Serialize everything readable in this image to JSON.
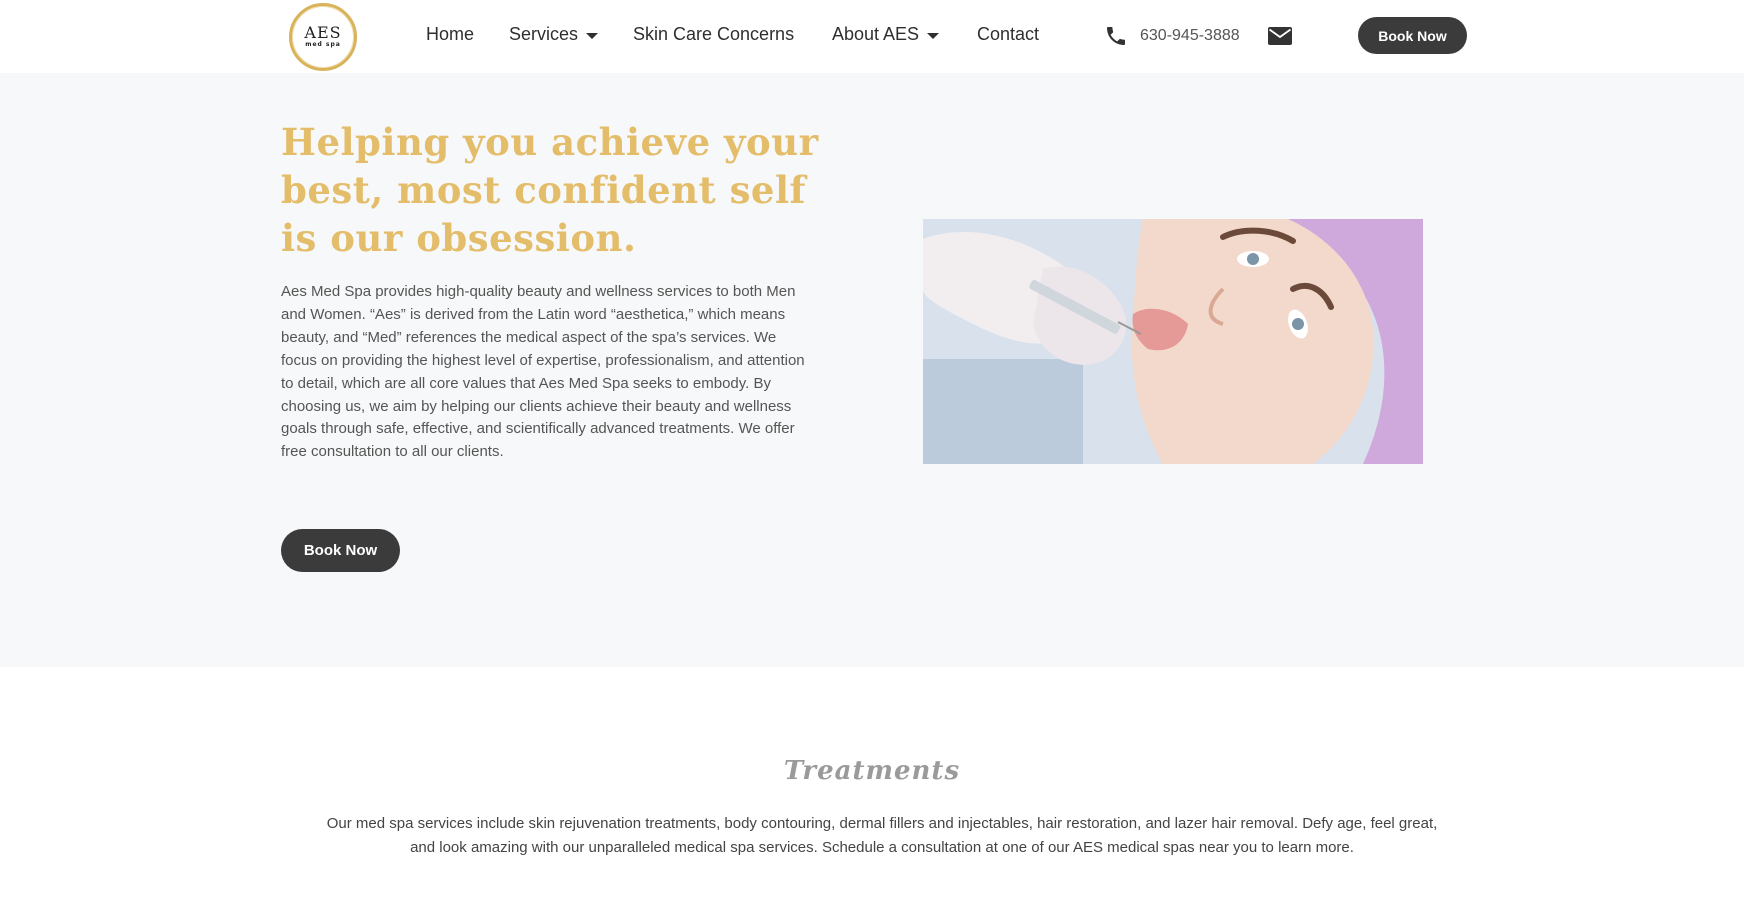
{
  "header": {
    "logo_main": "AES",
    "logo_sub": "med spa",
    "nav": [
      {
        "label": "Home"
      },
      {
        "label": "Services"
      },
      {
        "label": "Skin Care Concerns"
      },
      {
        "label": "About AES"
      },
      {
        "label": "Contact"
      }
    ],
    "phone": "630-945-3888",
    "book_label": "Book Now"
  },
  "hero": {
    "title": "Helping you achieve your best, most confident self is our obsession.",
    "body": "Aes Med Spa provides high-quality beauty and wellness services to both Men and Women. “Aes” is derived from the Latin word “aesthetica,” which means beauty, and “Med” references the medical aspect of the spa’s services. We focus on providing the highest level of expertise, professionalism, and attention to detail, which are all core values that Aes Med Spa seeks to embody. By choosing us, we aim by helping our clients achieve their beauty and wellness goals through safe, effective, and scientifically advanced treatments. We offer free consultation to all our clients.",
    "book_label": "Book Now"
  },
  "treatments": {
    "title": "Treatments",
    "body": "Our med spa services include skin rejuvenation treatments, body contouring, dermal fillers and injectables, hair restoration, and lazer hair removal. Defy age, feel great, and look amazing with our unparalleled medical spa services. Schedule a consultation at one of our AES medical spas near you to learn more."
  },
  "colors": {
    "accent_gold": "#e3bd6a",
    "button_dark": "#3b3b3b",
    "hero_bg": "#f7f8f9"
  },
  "icons": [
    "phone-icon",
    "mail-icon",
    "chevron-down-icon"
  ]
}
